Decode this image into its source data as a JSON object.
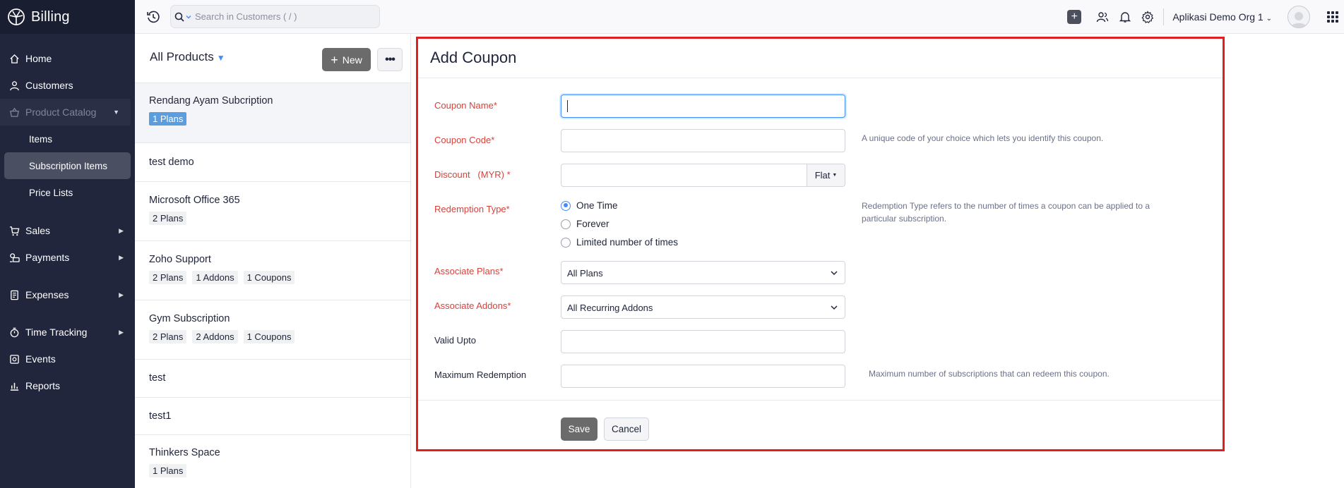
{
  "app": {
    "name": "Billing"
  },
  "sidebar": {
    "home": "Home",
    "customers": "Customers",
    "product_catalog": "Product Catalog",
    "items": "Items",
    "subscription_items": "Subscription Items",
    "price_lists": "Price Lists",
    "sales": "Sales",
    "payments": "Payments",
    "expenses": "Expenses",
    "time_tracking": "Time Tracking",
    "events": "Events",
    "reports": "Reports"
  },
  "topbar": {
    "search_placeholder": "Search in Customers ( / )",
    "org_name": "Aplikasi Demo Org 1"
  },
  "list": {
    "title": "All Products",
    "new_label": "New",
    "more_label": "•••",
    "rows": [
      {
        "name": "Rendang Ayam Subcription",
        "tags": [
          "1 Plans"
        ]
      },
      {
        "name": "test demo",
        "tags": []
      },
      {
        "name": "Microsoft Office 365",
        "tags": [
          "2 Plans"
        ]
      },
      {
        "name": "Zoho Support",
        "tags": [
          "2 Plans",
          "1 Addons",
          "1 Coupons"
        ]
      },
      {
        "name": "Gym Subscription",
        "tags": [
          "2 Plans",
          "2 Addons",
          "1 Coupons"
        ]
      },
      {
        "name": "test",
        "tags": []
      },
      {
        "name": "test1",
        "tags": []
      },
      {
        "name": "Thinkers Space",
        "tags": [
          "1 Plans"
        ]
      }
    ]
  },
  "form": {
    "title": "Add Coupon",
    "coupon_name_label": "Coupon Name*",
    "coupon_code_label": "Coupon Code*",
    "coupon_code_help": "A unique code of your choice which lets you identify this coupon.",
    "discount_label": "Discount   (MYR) *",
    "discount_type": "Flat",
    "redemption_type_label": "Redemption Type*",
    "redemption_options": [
      "One Time",
      "Forever",
      "Limited number of times"
    ],
    "redemption_selected": "One Time",
    "redemption_help": "Redemption Type refers to the number of times a coupon can be applied to a particular subscription.",
    "associate_plans_label": "Associate Plans*",
    "associate_plans_value": "All Plans",
    "associate_addons_label": "Associate Addons*",
    "associate_addons_value": "All Recurring Addons",
    "valid_upto_label": "Valid Upto",
    "max_redemption_label": "Maximum Redemption",
    "max_redemption_help": "Maximum number of subscriptions that can redeem this coupon.",
    "save_label": "Save",
    "cancel_label": "Cancel"
  },
  "colors": {
    "sidebar_bg": "#21263c",
    "required_label": "#d6423a",
    "accent": "#408dfb",
    "highlight_border": "#e02020"
  }
}
